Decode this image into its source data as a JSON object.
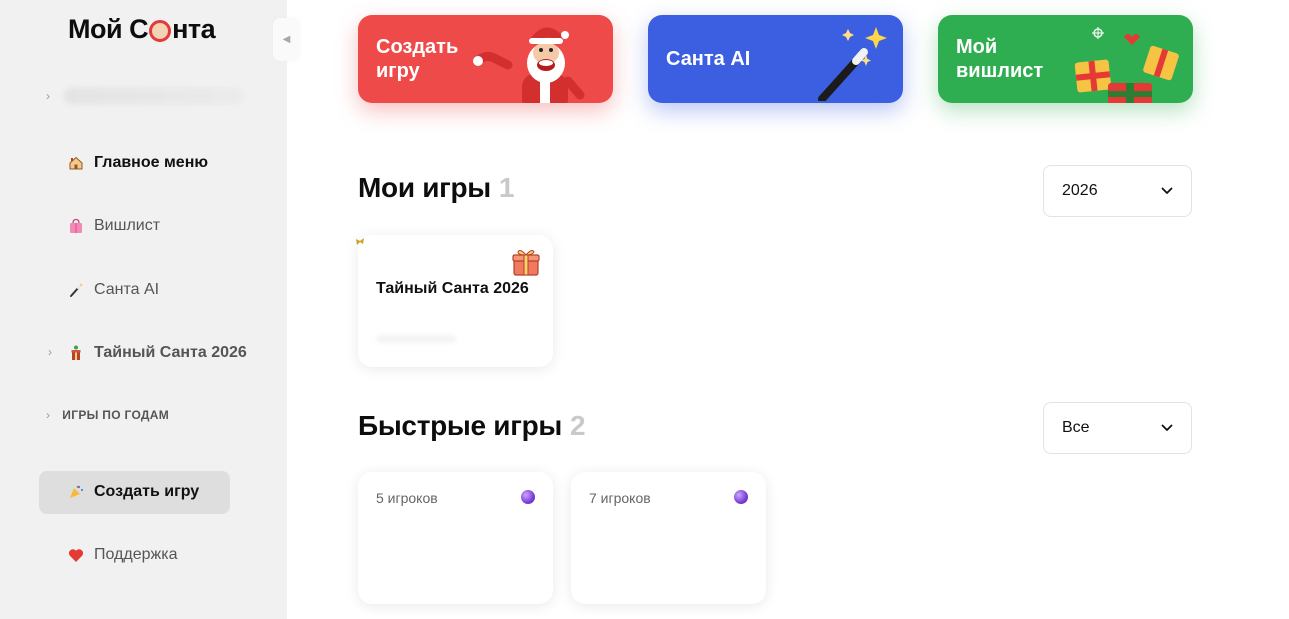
{
  "sidebar": {
    "logo": {
      "part1": "Мой С",
      "part2": "нта"
    },
    "collapse_icon": "chevron-left-icon",
    "nav": [
      {
        "label": "Главное меню",
        "icon": "house-icon",
        "active": true
      },
      {
        "label": "Вишлист",
        "icon": "shopping-bag-icon"
      },
      {
        "label": "Санта AI",
        "icon": "magic-wand-icon"
      },
      {
        "label": "Тайный Санта 2026",
        "icon": "gift-icon"
      }
    ],
    "section_label": "ИГРЫ ПО ГОДАМ",
    "create_label": "Создать игру",
    "create_icon": "party-popper-icon",
    "support_label": "Поддержка",
    "support_icon": "heart-icon"
  },
  "banners": [
    {
      "line1": "Создать",
      "line2": "игру",
      "color": "#ef4a4a"
    },
    {
      "line1": "Санта AI",
      "color": "#3b5fe0"
    },
    {
      "line1": "Мой",
      "line2": "вишлист",
      "color": "#2fae51"
    }
  ],
  "my_games": {
    "title": "Мои игры",
    "count": "1",
    "year_select": "2026",
    "cards": [
      {
        "title": "Тайный Санта 2026"
      }
    ]
  },
  "quick_games": {
    "title": "Быстрые игры",
    "count": "2",
    "filter_select": "Все",
    "cards": [
      {
        "players": "5 игроков"
      },
      {
        "players": "7 игроков"
      }
    ]
  }
}
